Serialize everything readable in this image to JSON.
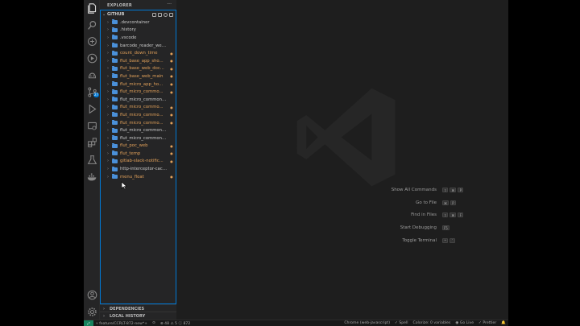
{
  "sidebar": {
    "title": "EXPLORER",
    "more": "···",
    "repo": "GITHUB",
    "folders": [
      {
        "name": ".devcontainer",
        "status": "",
        "color": "#cccccc"
      },
      {
        "name": ".history",
        "status": "",
        "color": "#cccccc"
      },
      {
        "name": ".vscode",
        "status": "",
        "color": "#cccccc"
      },
      {
        "name": "barcode_reader_webass...",
        "status": "",
        "color": "#cccccc"
      },
      {
        "name": "count_down_time",
        "status": "",
        "color": "#e2a15a"
      },
      {
        "name": "flut_base_app_sho...",
        "status": "",
        "color": "#e2a15a"
      },
      {
        "name": "flut_base_web_doc...",
        "status": "",
        "color": "#e2a15a"
      },
      {
        "name": "flut_base_web_main",
        "status": "",
        "color": "#e2a15a"
      },
      {
        "name": "flut_micro_app_ho...",
        "status": "",
        "color": "#e2a15a"
      },
      {
        "name": "flut_micro_commo...",
        "status": "",
        "color": "#e2a15a"
      },
      {
        "name": "flut_micro_commons_cli...",
        "status": "",
        "color": "#cccccc"
      },
      {
        "name": "flut_micro_commo...",
        "status": "",
        "color": "#e2a15a"
      },
      {
        "name": "flut_micro_commo...",
        "status": "",
        "color": "#e2a15a"
      },
      {
        "name": "flut_micro_commo...",
        "status": "",
        "color": "#e2a15a"
      },
      {
        "name": "flut_micro_commons_te...",
        "status": "",
        "color": "#cccccc"
      },
      {
        "name": "flut_micro_commons_utils",
        "status": "",
        "color": "#cccccc"
      },
      {
        "name": "flut_poc_web",
        "status": "",
        "color": "#e2a15a"
      },
      {
        "name": "flut_temp",
        "status": "",
        "color": "#e2a15a"
      },
      {
        "name": "gitlab-slack-notific...",
        "status": "",
        "color": "#e2a15a"
      },
      {
        "name": "http-interceptor-cache",
        "status": "",
        "color": "#cccccc"
      },
      {
        "name": "menu_float",
        "status": "",
        "color": "#e2a15a"
      }
    ],
    "dependencies": "DEPENDENCIES",
    "local_history": "LOCAL HISTORY"
  },
  "activity": {
    "scm_badge": "27"
  },
  "shortcuts": [
    {
      "label": "Show All Commands",
      "keys": [
        "⇧",
        "⌘",
        "P"
      ]
    },
    {
      "label": "Go to File",
      "keys": [
        "⌘",
        "P"
      ]
    },
    {
      "label": "Find in Files",
      "keys": [
        "⇧",
        "⌘",
        "F"
      ]
    },
    {
      "label": "Start Debugging",
      "keys": [
        "F5"
      ]
    },
    {
      "label": "Toggle Terminal",
      "keys": [
        "^",
        "`"
      ]
    }
  ],
  "statusbar": {
    "branch": "feature/CCRLT-872-new*+",
    "sync": "",
    "problems": "48 ⚠ 5 ⓘ 872",
    "language_env": "Chrome (web-javascript)",
    "spell": "Spell",
    "colorize": "Colorize: 0 variables",
    "go_live": "Go Live",
    "prettier": "Prettier"
  },
  "colors": {
    "accent": "#0078d4",
    "modified": "#e2a15a"
  }
}
